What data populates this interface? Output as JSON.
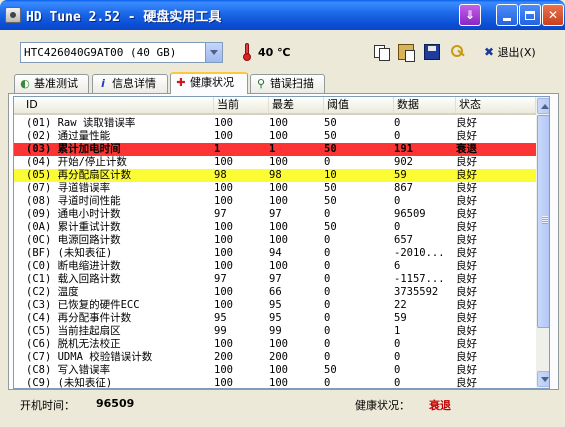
{
  "window": {
    "title": "HD Tune 2.52 - 硬盘实用工具",
    "download_glyph": "⇓",
    "close_glyph": "✕"
  },
  "toolbar": {
    "drive": "HTC426040G9AT00 (40 GB)",
    "temperature": "40 ℃",
    "exit_label": "退出(X)",
    "exit_glyph": "✖"
  },
  "tabs": [
    {
      "label": "基准测试",
      "icon": "speedometer-icon"
    },
    {
      "label": "信息详情",
      "icon": "info-icon"
    },
    {
      "label": "健康状况",
      "icon": "health-cross-icon",
      "active": true
    },
    {
      "label": "错误扫描",
      "icon": "magnifier-icon"
    }
  ],
  "table": {
    "columns": [
      "ID",
      "当前",
      "最差",
      "阈值",
      "数据",
      "状态"
    ],
    "rows": [
      [
        "(01) Raw 读取错误率",
        "100",
        "100",
        "50",
        "0",
        "良好"
      ],
      [
        "(02) 通过量性能",
        "100",
        "100",
        "50",
        "0",
        "良好"
      ],
      [
        "(03) 累计加电时间",
        "1",
        "1",
        "50",
        "191",
        "衰退"
      ],
      [
        "(04) 开始/停止计数",
        "100",
        "100",
        "0",
        "902",
        "良好"
      ],
      [
        "(05) 再分配扇区计数",
        "98",
        "98",
        "10",
        "59",
        "良好"
      ],
      [
        "(07) 寻道错误率",
        "100",
        "100",
        "50",
        "867",
        "良好"
      ],
      [
        "(08) 寻道时间性能",
        "100",
        "100",
        "50",
        "0",
        "良好"
      ],
      [
        "(09) 通电小时计数",
        "97",
        "97",
        "0",
        "96509",
        "良好"
      ],
      [
        "(0A) 累计重试计数",
        "100",
        "100",
        "50",
        "0",
        "良好"
      ],
      [
        "(0C) 电源回路计数",
        "100",
        "100",
        "0",
        "657",
        "良好"
      ],
      [
        "(BF) (未知表征)",
        "100",
        "94",
        "0",
        "-2010...",
        "良好"
      ],
      [
        "(C0) 断电缩进计数",
        "100",
        "100",
        "0",
        "6",
        "良好"
      ],
      [
        "(C1) 载入回路计数",
        "97",
        "97",
        "0",
        "-1157...",
        "良好"
      ],
      [
        "(C2) 温度",
        "100",
        "66",
        "0",
        "3735592",
        "良好"
      ],
      [
        "(C3) 已恢复的硬件ECC",
        "100",
        "95",
        "0",
        "22",
        "良好"
      ],
      [
        "(C4) 再分配事件计数",
        "95",
        "95",
        "0",
        "59",
        "良好"
      ],
      [
        "(C5) 当前挂起扇区",
        "99",
        "99",
        "0",
        "1",
        "良好"
      ],
      [
        "(C6) 脱机无法校正",
        "100",
        "100",
        "0",
        "0",
        "良好"
      ],
      [
        "(C7) UDMA 校验错误计数",
        "200",
        "200",
        "0",
        "0",
        "良好"
      ],
      [
        "(C8) 写入错误率",
        "100",
        "100",
        "50",
        "0",
        "良好"
      ],
      [
        "(C9) (未知表征)",
        "100",
        "100",
        "0",
        "0",
        "良好"
      ]
    ],
    "highlight_red_row": 2,
    "highlight_yellow_row": 4,
    "colors": {
      "red": "#fc3434",
      "yellow": "#fcfc34"
    }
  },
  "status": {
    "uptime_label": "开机时间：",
    "uptime_value": "96509",
    "health_label": "健康状况：",
    "health_value": "衰退",
    "health_color": "#c00000"
  }
}
